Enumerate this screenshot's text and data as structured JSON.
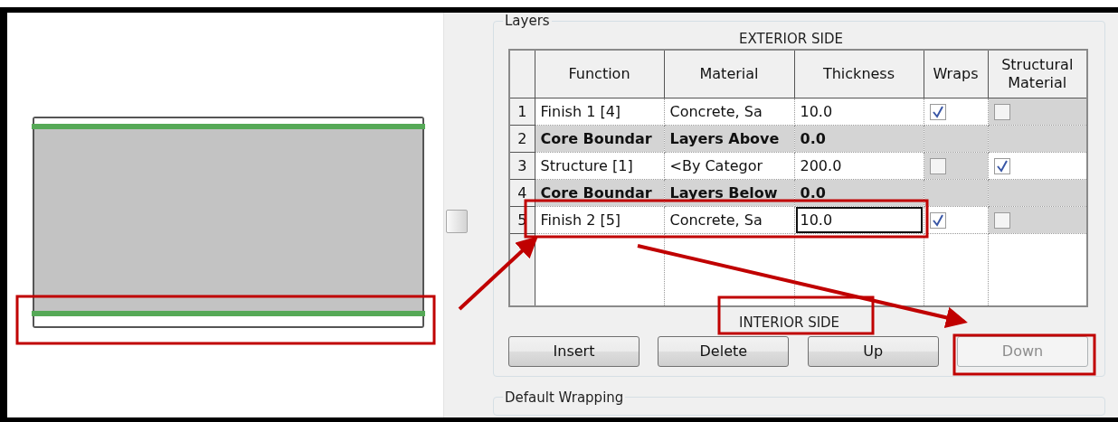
{
  "preview": {
    "kind": "wall-section"
  },
  "layers": {
    "title": "Layers",
    "top_label": "EXTERIOR SIDE",
    "columns": [
      "Function",
      "Material",
      "Thickness",
      "Wraps",
      "Structural Material"
    ],
    "rows": [
      {
        "number": "1",
        "kind": "layer",
        "function": "Finish 1 [4]",
        "material": "Concrete, Sa",
        "thickness": "10.0",
        "editing": false,
        "wraps": {
          "checked": true,
          "disabled": false
        },
        "structural": {
          "checked": false,
          "disabled": true
        }
      },
      {
        "number": "2",
        "kind": "boundary",
        "function": "Core Boundar",
        "material": "Layers Above",
        "thickness": "0.0"
      },
      {
        "number": "3",
        "kind": "layer",
        "function": "Structure [1]",
        "material": "<By Categor",
        "thickness": "200.0",
        "editing": false,
        "wraps": {
          "checked": false,
          "disabled": true
        },
        "structural": {
          "checked": true,
          "disabled": false
        }
      },
      {
        "number": "4",
        "kind": "boundary",
        "function": "Core Boundar",
        "material": "Layers Below",
        "thickness": "0.0"
      },
      {
        "number": "5",
        "kind": "layer",
        "function": "Finish 2 [5]",
        "material": "Concrete, Sa",
        "thickness": "10.0",
        "editing": true,
        "wraps": {
          "checked": true,
          "disabled": false
        },
        "structural": {
          "checked": false,
          "disabled": true
        }
      }
    ],
    "bottom_label": "INTERIOR SIDE",
    "buttons": [
      {
        "label": "Insert",
        "disabled": false
      },
      {
        "label": "Delete",
        "disabled": false
      },
      {
        "label": "Up",
        "disabled": false
      },
      {
        "label": "Down",
        "disabled": true
      }
    ]
  },
  "default_wrapping": {
    "title": "Default Wrapping"
  }
}
